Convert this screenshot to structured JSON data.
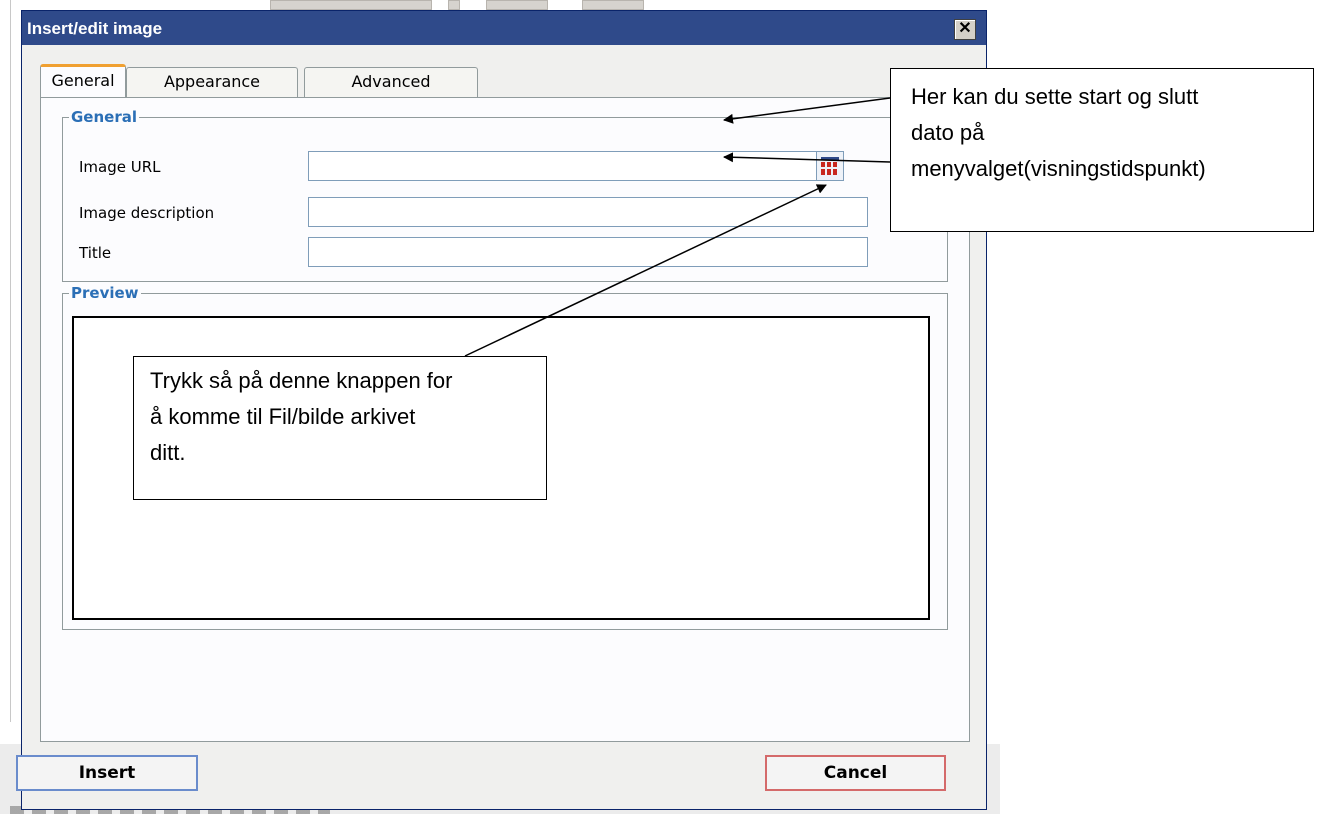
{
  "dialog": {
    "title": "Insert/edit image",
    "close_glyph": "✕",
    "tabs": [
      {
        "label": "General",
        "active": true
      },
      {
        "label": "Appearance",
        "active": false
      },
      {
        "label": "Advanced",
        "active": false
      }
    ],
    "general": {
      "legend": "General",
      "fields": [
        {
          "label": "Image URL",
          "value": ""
        },
        {
          "label": "Image description",
          "value": ""
        },
        {
          "label": "Title",
          "value": ""
        }
      ],
      "browse_icon": "browse-image-icon"
    },
    "preview": {
      "legend": "Preview"
    },
    "buttons": {
      "insert": "Insert",
      "cancel": "Cancel"
    }
  },
  "annotations": {
    "top_right": {
      "lines": [
        "Her kan du sette start og slutt",
        "dato på",
        "menyvalget(visningstidspunkt)"
      ]
    },
    "middle": {
      "lines": [
        "Trykk så på denne knappen for",
        "å komme til Fil/bilde arkivet",
        "ditt."
      ]
    }
  },
  "colors": {
    "titlebar": "#2f4a8a",
    "legend": "#2b6fb6",
    "active_tab_accent": "#f0a030",
    "insert_border": "#6a8ccc",
    "cancel_border": "#d46a6a"
  }
}
